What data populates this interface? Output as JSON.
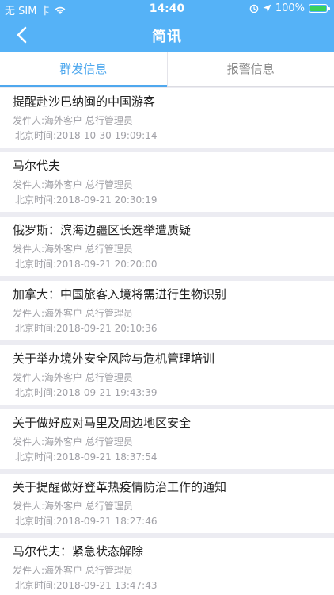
{
  "status_bar": {
    "carrier": "无 SIM 卡",
    "time": "14:40",
    "battery": "100%",
    "icons": [
      "wifi-icon",
      "location-icon",
      "alarm-icon",
      "battery-icon"
    ]
  },
  "header": {
    "title": "简讯",
    "back_icon": "back-chevron-icon",
    "background": "#55b2f7"
  },
  "tabs": [
    {
      "label": "群发信息",
      "active": true
    },
    {
      "label": "报警信息",
      "active": false
    }
  ],
  "accent": "#4fa8ee",
  "messages": [
    {
      "title": "提醒赴沙巴纳闽的中国游客",
      "sender": "发件人:海外客户 总行管理员",
      "time": "北京时间:2018-10-30 19:09:14"
    },
    {
      "title": "马尔代夫",
      "sender": "发件人:海外客户 总行管理员",
      "time": "北京时间:2018-09-21 20:30:19"
    },
    {
      "title": "俄罗斯：滨海边疆区长选举遭质疑",
      "sender": "发件人:海外客户 总行管理员",
      "time": "北京时间:2018-09-21 20:20:00"
    },
    {
      "title": "加拿大：中国旅客入境将需进行生物识别",
      "sender": "发件人:海外客户 总行管理员",
      "time": "北京时间:2018-09-21 20:10:36"
    },
    {
      "title": "关于举办境外安全风险与危机管理培训",
      "sender": "发件人:海外客户 总行管理员",
      "time": "北京时间:2018-09-21 19:43:39"
    },
    {
      "title": "关于做好应对马里及周边地区安全",
      "sender": "发件人:海外客户 总行管理员",
      "time": "北京时间:2018-09-21 18:37:54"
    },
    {
      "title": "关于提醒做好登革热疫情防治工作的通知",
      "sender": "发件人:海外客户 总行管理员",
      "time": "北京时间:2018-09-21 18:27:46"
    },
    {
      "title": "马尔代夫：紧急状态解除",
      "sender": "发件人:海外客户 总行管理员",
      "time": "北京时间:2018-09-21 13:47:43"
    }
  ]
}
